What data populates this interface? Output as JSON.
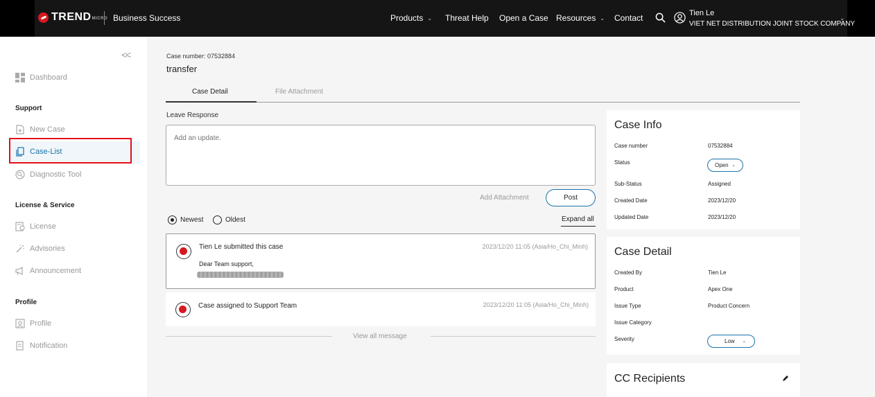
{
  "header": {
    "logo_text": "TREND",
    "logo_micro": "MICRO",
    "subtitle": "Business Success",
    "nav": [
      {
        "label": "Products",
        "has_menu": true
      },
      {
        "label": "Threat Help",
        "has_menu": false
      },
      {
        "label": "Open a Case",
        "has_menu": false
      },
      {
        "label": "Resources",
        "has_menu": true
      },
      {
        "label": "Contact",
        "has_menu": false
      }
    ],
    "user_name": "Tien Le",
    "user_company": "VIET NET DISTRIBUTION JOINT STOCK COMPANY"
  },
  "sidebar": {
    "collapse": "<<",
    "dashboard": "Dashboard",
    "sections": {
      "support": "Support",
      "license": "License & Service",
      "profile": "Profile"
    },
    "items": {
      "new_case": "New Case",
      "case_list": "Case-List",
      "diagnostic": "Diagnostic Tool",
      "license": "License",
      "advisories": "Advisories",
      "announcement": "Announcement",
      "profile": "Profile",
      "notification": "Notification"
    }
  },
  "case": {
    "number_label": "Case number: 07532884",
    "title": "transfer",
    "tabs": [
      "Case Detail",
      "File Attachment"
    ],
    "leave_response": "Leave Response",
    "placeholder": "Add an update.",
    "add_attachment": "Add Attachment",
    "post": "Post",
    "sort_newest": "Newest",
    "sort_oldest": "Oldest",
    "expand_all": "Expand all",
    "messages": [
      {
        "title": "Tien Le submitted this case",
        "time": "2023/12/20 11:05 (Asia/Ho_Chi_Minh)",
        "body": "Dear Team support,"
      },
      {
        "title": "Case assigned to Support Team",
        "time": "2023/12/20 11:05 (Asia/Ho_Chi_Minh)"
      }
    ],
    "view_all": "View all message"
  },
  "case_info": {
    "title": "Case Info",
    "rows": [
      {
        "key": "Case number",
        "value": "07532884"
      },
      {
        "key": "Status",
        "value": "Open"
      },
      {
        "key": "Sub-Status",
        "value": "Assigned"
      },
      {
        "key": "Created Date",
        "value": "2023/12/20"
      },
      {
        "key": "Updated Date",
        "value": "2023/12/20"
      }
    ]
  },
  "case_detail": {
    "title": "Case Detail",
    "rows": [
      {
        "key": "Created By",
        "value": "Tien Le"
      },
      {
        "key": "Product",
        "value": "Apex One"
      },
      {
        "key": "Issue Type",
        "value": "Product Concern"
      },
      {
        "key": "Issue Category",
        "value": ""
      },
      {
        "key": "Severity",
        "value": "Low"
      }
    ]
  },
  "cc": {
    "title": "CC Recipients"
  },
  "colors": {
    "accent": "#1a73a8",
    "brand_red": "#d71920",
    "highlight_box": "#e0101a"
  }
}
